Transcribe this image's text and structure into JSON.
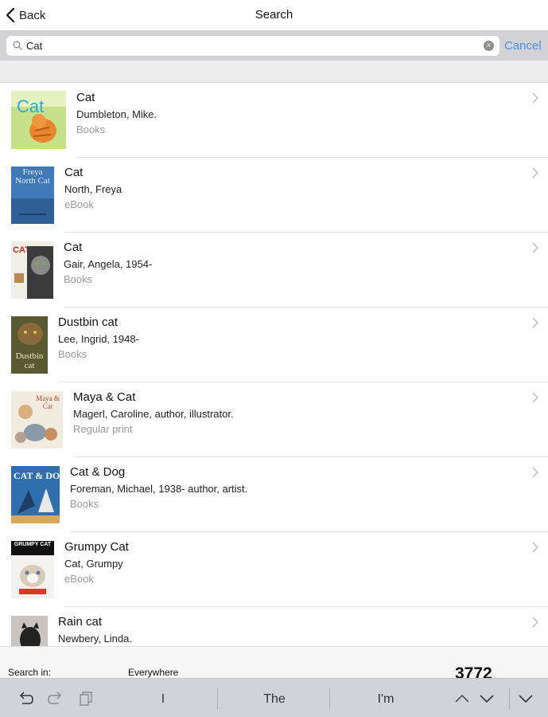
{
  "nav": {
    "back_label": "Back",
    "title": "Search"
  },
  "search": {
    "query": "Cat",
    "cancel_label": "Cancel"
  },
  "results": [
    {
      "title": "Cat",
      "author": "Dumbleton, Mike.",
      "format": "Books"
    },
    {
      "title": "Cat",
      "author": "North, Freya",
      "format": "eBook"
    },
    {
      "title": "Cat",
      "author": "Gair, Angela, 1954-",
      "format": "Books"
    },
    {
      "title": "Dustbin cat",
      "author": "Lee, Ingrid, 1948-",
      "format": "Books"
    },
    {
      "title": "Maya & Cat",
      "author": "Magerl, Caroline, author, illustrator.",
      "format": "Regular print"
    },
    {
      "title": "Cat & Dog",
      "author": "Foreman, Michael, 1938- author, artist.",
      "format": "Books"
    },
    {
      "title": "Grumpy Cat",
      "author": "Cat, Grumpy",
      "format": "eBook"
    },
    {
      "title": "Rain cat",
      "author": "Newbery, Linda.",
      "format": ""
    }
  ],
  "covers": [
    {
      "text": "Cat",
      "bg": "#c7e08a",
      "accent": "#2aa9d8"
    },
    {
      "text": "Freya North Cat",
      "bg": "#3f79b8",
      "accent": "#e8eef5"
    },
    {
      "text": "CAT",
      "bg": "#f1eee6",
      "accent": "#cc2a22"
    },
    {
      "text": "Dustbin cat",
      "bg": "#5a5a32",
      "accent": "#e9e4c0"
    },
    {
      "text": "Maya & Cat",
      "bg": "#f2ece0",
      "accent": "#c24a2a"
    },
    {
      "text": "CAT & DOG",
      "bg": "#2f6fae",
      "accent": "#ffffff"
    },
    {
      "text": "GRUMPY CAT",
      "bg": "#f4f2ef",
      "accent": "#111111"
    },
    {
      "text": "",
      "bg": "#c9c4c0",
      "accent": "#222222"
    }
  ],
  "footer": {
    "search_in_label": "Search in:",
    "scope": "Everywhere",
    "count": "3772"
  },
  "keyboard": {
    "suggestions": [
      "I",
      "The",
      "I'm"
    ]
  },
  "colors": {
    "accent": "#4a8ef0",
    "searchbar_bg": "#d3d3d6",
    "keyboard_bar_bg": "#d1d3d9"
  }
}
